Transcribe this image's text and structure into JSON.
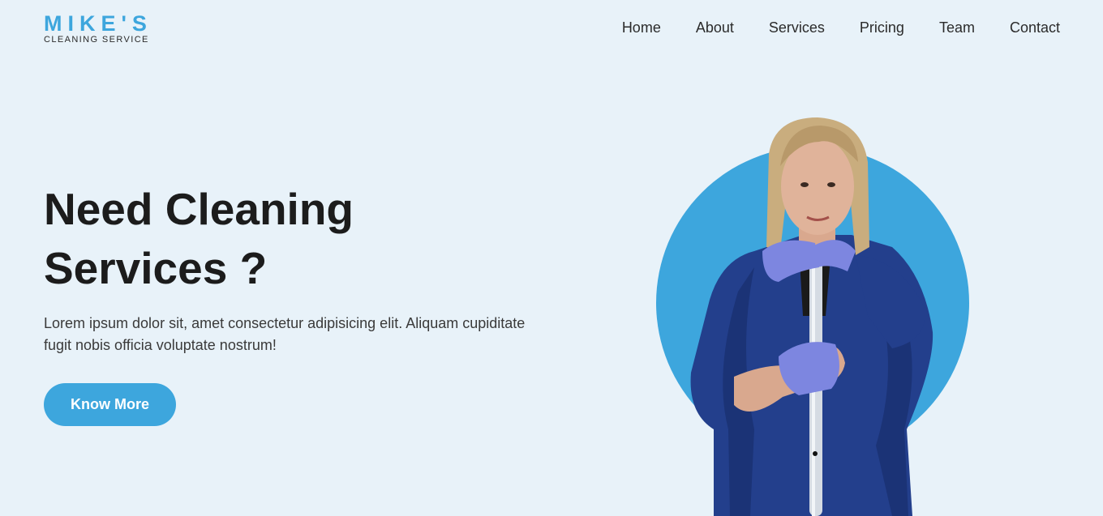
{
  "brand": {
    "name": "MIKE'S",
    "tagline": "CLEANING SERVICE",
    "accent_color": "#3da6dd"
  },
  "nav": {
    "items": [
      {
        "label": "Home"
      },
      {
        "label": "About"
      },
      {
        "label": "Services"
      },
      {
        "label": "Pricing"
      },
      {
        "label": "Team"
      },
      {
        "label": "Contact"
      }
    ]
  },
  "hero": {
    "title_line1": "Need Cleaning",
    "title_line2": "Services ?",
    "text": "Lorem ipsum dolor sit, amet consectetur adipisicing elit. Aliquam cupiditate fugit nobis officia voluptate nostrum!",
    "cta_label": "Know More"
  },
  "illustration": {
    "subject": "cleaner-with-mop-photo"
  }
}
